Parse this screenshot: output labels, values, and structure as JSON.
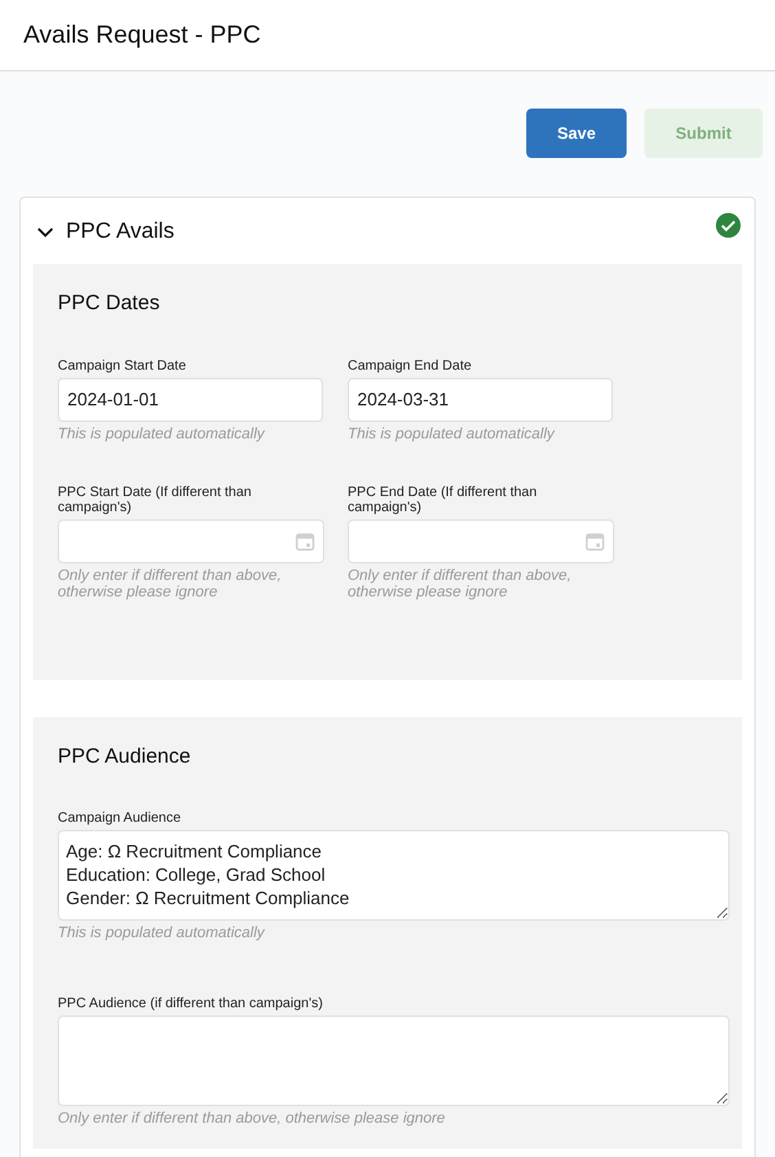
{
  "header": {
    "title": "Avails Request - PPC"
  },
  "buttons": [
    {
      "label": "Save",
      "disabled": false
    },
    {
      "label": "Submit",
      "disabled": true
    }
  ],
  "panel": {
    "title": "PPC Avails",
    "expanded": true,
    "complete": true,
    "sections": [
      {
        "title": "PPC Dates",
        "fields": [
          {
            "kind": "text",
            "label": "Campaign Start Date",
            "value": "2024-01-01",
            "hint": "This is populated automatically"
          },
          {
            "kind": "text",
            "label": "Campaign End Date",
            "value": "2024-03-31",
            "hint": "This is populated automatically"
          },
          {
            "kind": "date",
            "label": "PPC Start Date (If different than campaign's)",
            "hint": "Only enter if different than above, otherwise please ignore"
          },
          {
            "kind": "date",
            "label": "PPC End Date (If different than campaign's)",
            "hint": "Only enter if different than above, otherwise please ignore"
          }
        ]
      },
      {
        "title": "PPC Audience",
        "fields": [
          {
            "kind": "textarea",
            "label": "Campaign Audience",
            "value": "Age: Ω Recruitment Compliance\nEducation: College, Grad School\nGender: Ω Recruitment Compliance",
            "hint": "This is populated automatically"
          },
          {
            "kind": "textarea",
            "label": "PPC Audience (if different than campaign's)",
            "hint": "Only enter if different than above, otherwise please ignore"
          }
        ]
      }
    ]
  }
}
